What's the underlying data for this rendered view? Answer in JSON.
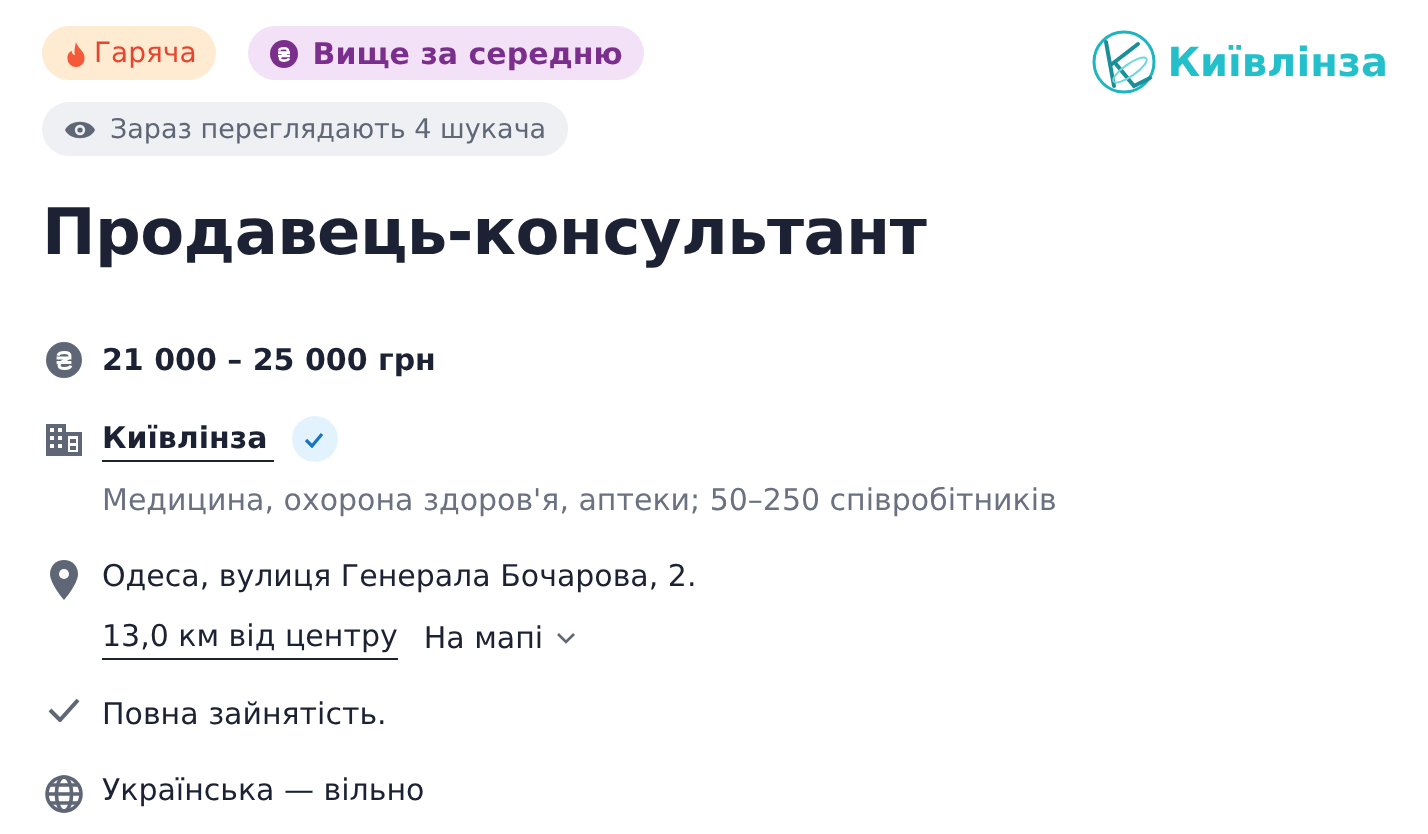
{
  "badges": [
    {
      "kind": "hot",
      "text": "Гаряча"
    },
    {
      "kind": "salary",
      "text": "Вище за середню"
    }
  ],
  "viewers": {
    "text": "Зараз переглядають 4 шукача"
  },
  "logo": {
    "text": "Київлінза"
  },
  "title": "Продавець-консультант",
  "salary": "21 000 – 25 000 грн",
  "company": {
    "name": "Київлінза",
    "verified": true,
    "description": "Медицина, охорона здоров'я, аптеки; 50–250 співробітників"
  },
  "address": {
    "text": "Одеса, вулиця Генерала Бочарова, 2.",
    "distance": "13,0 км від центру",
    "map_link": "На мапі"
  },
  "employment": "Повна зайнятість.",
  "language": "Українська — вільно"
}
